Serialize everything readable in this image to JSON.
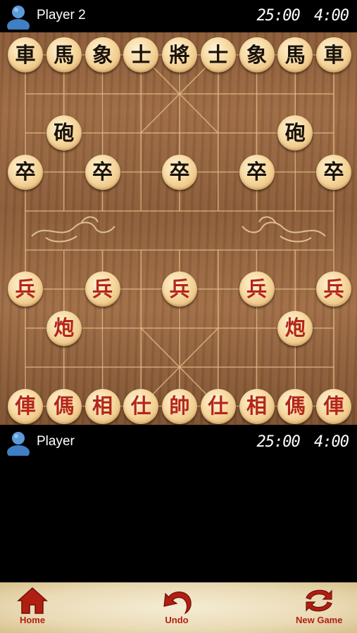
{
  "top_player": {
    "name": "Player 2",
    "timer_total": "25:00",
    "timer_move": "4:00"
  },
  "bottom_player": {
    "name": "Player",
    "timer_total": "25:00",
    "timer_move": "4:00"
  },
  "board": {
    "black_back_row": [
      "車",
      "馬",
      "象",
      "士",
      "將",
      "士",
      "象",
      "馬",
      "車"
    ],
    "black_cannon": "砲",
    "black_soldier": "卒",
    "red_back_row": [
      "俥",
      "傌",
      "相",
      "仕",
      "帥",
      "仕",
      "相",
      "傌",
      "俥"
    ],
    "red_cannon": "炮",
    "red_soldier": "兵"
  },
  "toolbar": {
    "home_label": "Home",
    "undo_label": "Undo",
    "new_game_label": "New Game"
  },
  "colors": {
    "red_piece": "#b3261a",
    "black_piece": "#1a1208",
    "toolbar_label": "#b11e12"
  },
  "icons": [
    "user-avatar-icon",
    "home-icon",
    "undo-icon",
    "new-game-icon"
  ]
}
